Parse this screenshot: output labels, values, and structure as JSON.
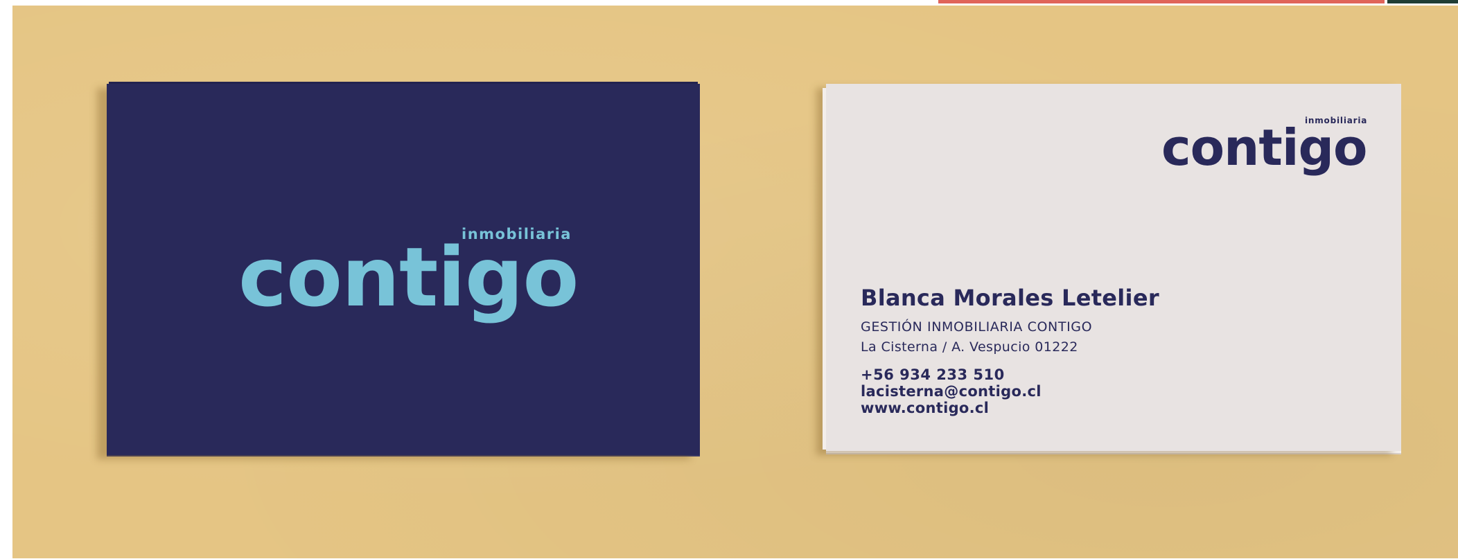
{
  "brand": {
    "wordmark": "contigo",
    "tagline": "inmobiliaria"
  },
  "contact": {
    "name": "Blanca Morales Letelier",
    "company": "GESTIÓN INMOBILIARIA CONTIGO",
    "address": "La Cisterna / A. Vespucio 01222",
    "phone": "+56 934 233 510",
    "email": "lacisterna@contigo.cl",
    "website": "www.contigo.cl"
  },
  "colors": {
    "background": "#e5c584",
    "navy": "#29295a",
    "light_blue": "#78c3d8",
    "card_white": "#e8e3e2"
  }
}
